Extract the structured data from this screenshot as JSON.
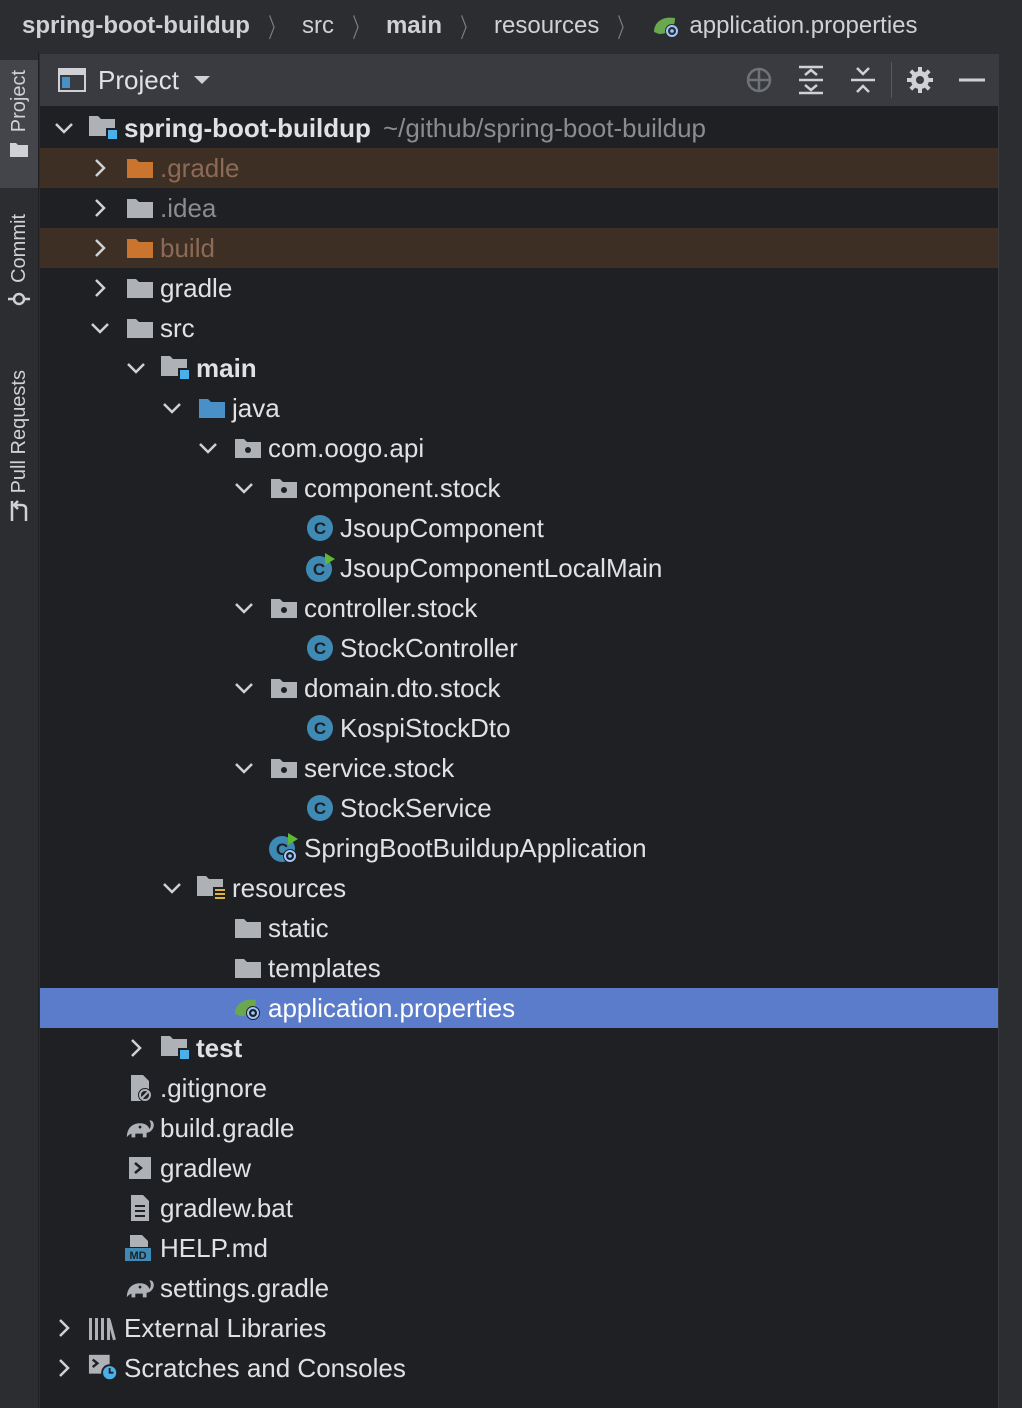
{
  "breadcrumb": {
    "items": [
      "spring-boot-buildup",
      "src",
      "main",
      "resources",
      "application.properties"
    ]
  },
  "sidebar": {
    "tabs": [
      "Project",
      "Commit",
      "Pull Requests"
    ]
  },
  "panel": {
    "title": "Project"
  },
  "tree": [
    {
      "label": "spring-boot-buildup",
      "suffix": "~/github/spring-boot-buildup",
      "depth": 0,
      "arrow": "down",
      "icon": "module-folder-icon",
      "bold": true
    },
    {
      "label": ".gradle",
      "depth": 1,
      "arrow": "right",
      "icon": "folder-excluded-icon",
      "state": "excluded"
    },
    {
      "label": ".idea",
      "depth": 1,
      "arrow": "right",
      "icon": "folder-icon",
      "state": "dim"
    },
    {
      "label": "build",
      "depth": 1,
      "arrow": "right",
      "icon": "folder-excluded-icon",
      "state": "excluded"
    },
    {
      "label": "gradle",
      "depth": 1,
      "arrow": "right",
      "icon": "folder-icon"
    },
    {
      "label": "src",
      "depth": 1,
      "arrow": "down",
      "icon": "folder-icon"
    },
    {
      "label": "main",
      "depth": 2,
      "arrow": "down",
      "icon": "module-folder-icon",
      "bold": true
    },
    {
      "label": "java",
      "depth": 3,
      "arrow": "down",
      "icon": "source-folder-icon"
    },
    {
      "label": "com.oogo.api",
      "depth": 4,
      "arrow": "down",
      "icon": "package-icon"
    },
    {
      "label": "component.stock",
      "depth": 5,
      "arrow": "down",
      "icon": "package-icon"
    },
    {
      "label": "JsoupComponent",
      "depth": 6,
      "arrow": "none",
      "icon": "java-class-icon"
    },
    {
      "label": "JsoupComponentLocalMain",
      "depth": 6,
      "arrow": "none",
      "icon": "java-class-runnable-icon"
    },
    {
      "label": "controller.stock",
      "depth": 5,
      "arrow": "down",
      "icon": "package-icon"
    },
    {
      "label": "StockController",
      "depth": 6,
      "arrow": "none",
      "icon": "java-class-icon"
    },
    {
      "label": "domain.dto.stock",
      "depth": 5,
      "arrow": "down",
      "icon": "package-icon"
    },
    {
      "label": "KospiStockDto",
      "depth": 6,
      "arrow": "none",
      "icon": "java-class-icon"
    },
    {
      "label": "service.stock",
      "depth": 5,
      "arrow": "down",
      "icon": "package-icon"
    },
    {
      "label": "StockService",
      "depth": 6,
      "arrow": "none",
      "icon": "java-class-icon"
    },
    {
      "label": "SpringBootBuildupApplication",
      "depth": 5,
      "arrow": "none",
      "icon": "spring-boot-class-icon"
    },
    {
      "label": "resources",
      "depth": 3,
      "arrow": "down",
      "icon": "resources-folder-icon"
    },
    {
      "label": "static",
      "depth": 4,
      "arrow": "none",
      "icon": "folder-icon"
    },
    {
      "label": "templates",
      "depth": 4,
      "arrow": "none",
      "icon": "folder-icon"
    },
    {
      "label": "application.properties",
      "depth": 4,
      "arrow": "none",
      "icon": "spring-properties-icon",
      "state": "selected"
    },
    {
      "label": "test",
      "depth": 2,
      "arrow": "right",
      "icon": "module-folder-icon",
      "bold": true
    },
    {
      "label": ".gitignore",
      "depth": 1,
      "arrow": "none",
      "icon": "gitignore-icon"
    },
    {
      "label": "build.gradle",
      "depth": 1,
      "arrow": "none",
      "icon": "gradle-icon"
    },
    {
      "label": "gradlew",
      "depth": 1,
      "arrow": "none",
      "icon": "shell-script-icon"
    },
    {
      "label": "gradlew.bat",
      "depth": 1,
      "arrow": "none",
      "icon": "text-file-icon"
    },
    {
      "label": "HELP.md",
      "depth": 1,
      "arrow": "none",
      "icon": "markdown-icon"
    },
    {
      "label": "settings.gradle",
      "depth": 1,
      "arrow": "none",
      "icon": "gradle-icon"
    },
    {
      "label": "External Libraries",
      "depth": 0,
      "arrow": "right",
      "icon": "libraries-icon"
    },
    {
      "label": "Scratches and Consoles",
      "depth": 0,
      "arrow": "right",
      "icon": "scratches-icon"
    }
  ]
}
